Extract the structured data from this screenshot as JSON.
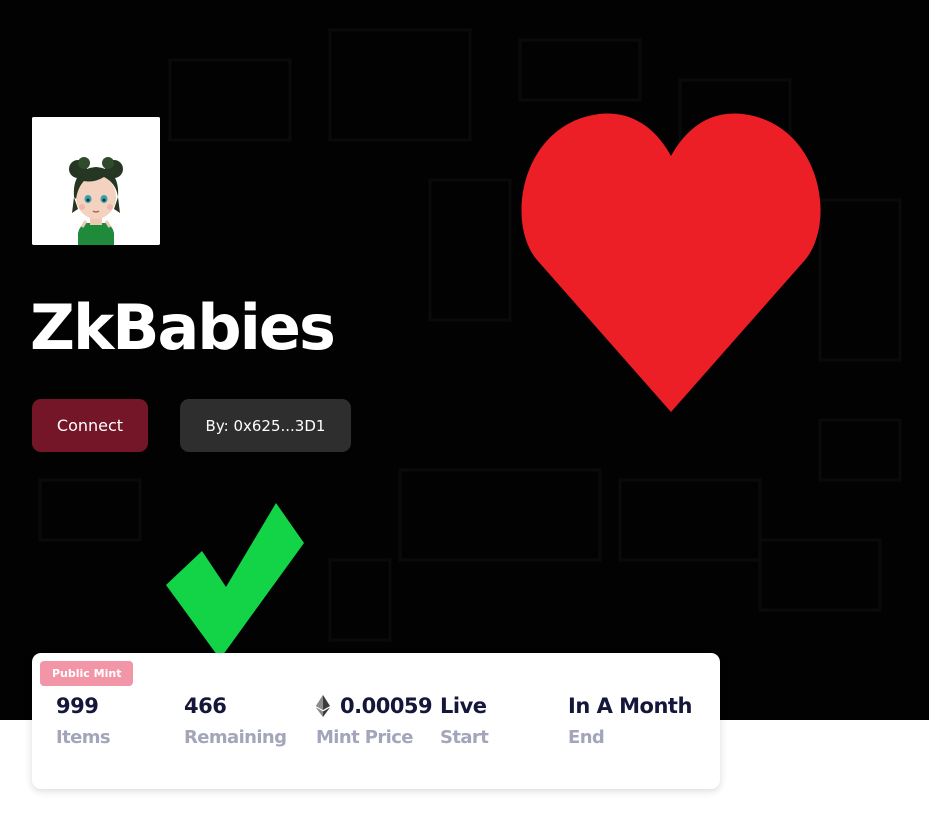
{
  "collection": {
    "name": "ZkBabies",
    "avatar_icon": "baby-avatar"
  },
  "actions": {
    "connect_label": "Connect",
    "creator_label": "By: 0x625...3D1"
  },
  "overlays": {
    "heart_icon": "heart-icon",
    "heart_color": "#ec1f27",
    "check_icon": "checkmark-icon",
    "check_color": "#13d446"
  },
  "mint": {
    "badge": "Public Mint",
    "stats": [
      {
        "value": "999",
        "label": "Items"
      },
      {
        "value": "466",
        "label": "Remaining"
      },
      {
        "value": "0.00059",
        "label": "Mint Price",
        "icon": "ethereum-icon"
      },
      {
        "value": "Live",
        "label": "Start"
      },
      {
        "value": "In A Month",
        "label": "End"
      }
    ]
  },
  "colors": {
    "hero_background": "#030202",
    "connect_button": "#741628",
    "creator_button": "#2e2e2e",
    "badge": "#f195a7",
    "stat_value": "#14163a",
    "stat_label": "#a3a6bb"
  }
}
